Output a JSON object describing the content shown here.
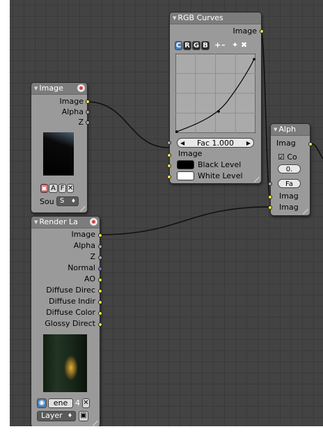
{
  "image_node": {
    "title": "Image",
    "outputs": [
      "Image",
      "Alpha",
      "Z"
    ],
    "controls": {
      "btn_a": "A",
      "btn_f": "F",
      "source_label": "Sou",
      "source_value": "S"
    }
  },
  "rgb_curves": {
    "title": "RGB Curves",
    "output": "Image",
    "channels": [
      "C",
      "R",
      "G",
      "B"
    ],
    "tools": [
      "+",
      "–",
      "✦",
      "✖"
    ],
    "fac_label": "Fac 1.000",
    "inputs": [
      "Image",
      "Black Level",
      "White Level"
    ],
    "black_color": "#000000",
    "white_color": "#ffffff"
  },
  "alpha_node": {
    "title": "Alph",
    "output": "Imag",
    "checkbox_label": "Co",
    "value_label": "0.",
    "fac_label": "Fa",
    "inputs": [
      "Imag",
      "Imag"
    ]
  },
  "render_layers": {
    "title": "Render La",
    "outputs": [
      "Image",
      "Alpha",
      "Z",
      "Normal",
      "AO",
      "Diffuse Direc",
      "Diffuse Indir",
      "Diffuse Color",
      "Glossy Direct"
    ],
    "scene_label": "ene",
    "scene_users": "4",
    "layer_label": "Layer"
  },
  "colors": {
    "background": "#434343",
    "node_body": "#9a9a9a",
    "node_header": "#7c7c7c",
    "socket_image": "#f5e53a",
    "socket_value": "#a4a4a4",
    "socket_vector": "#6f74d8",
    "wire": "#000000"
  }
}
